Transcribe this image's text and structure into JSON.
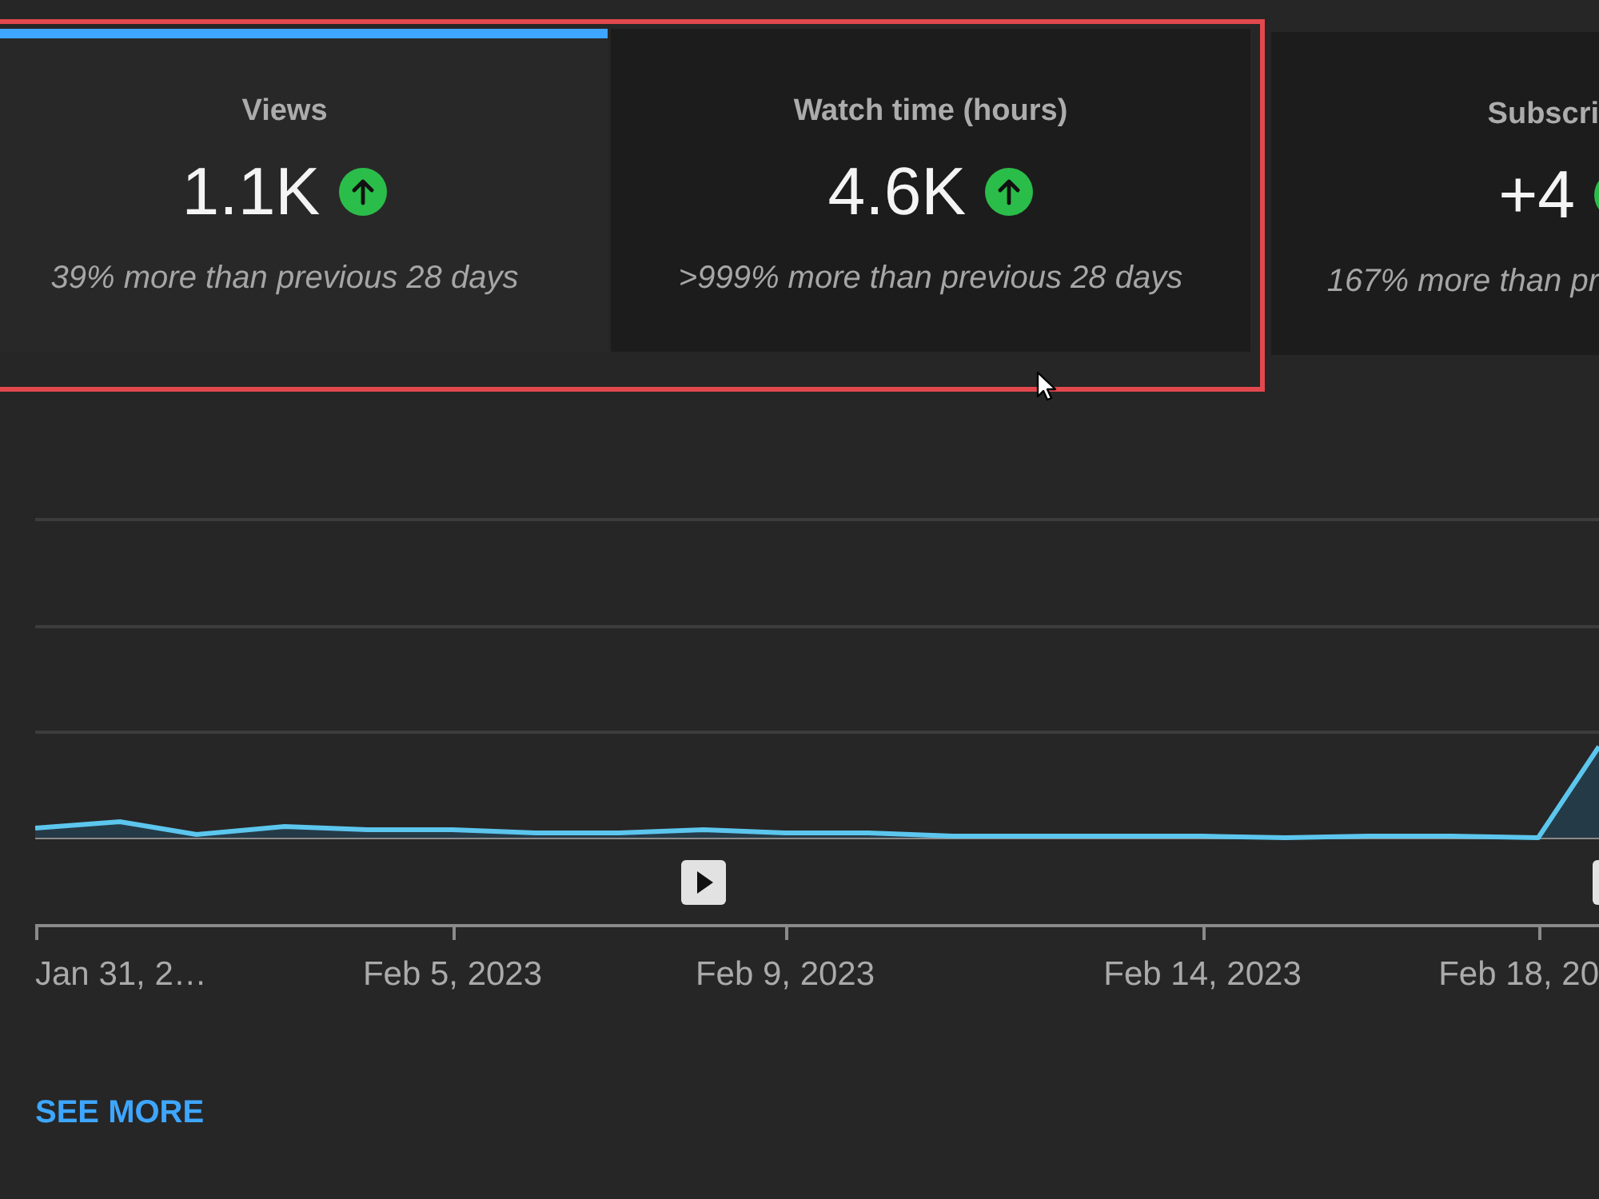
{
  "metric_cards": [
    {
      "title": "Views",
      "value": "1.1K",
      "increased": true,
      "comparison": "39% more than previous 28 days",
      "selected": true
    },
    {
      "title": "Watch time (hours)",
      "value": "4.6K",
      "increased": true,
      "comparison": ">999% more than previous 28 days",
      "selected": false
    },
    {
      "title": "Subscri",
      "value": "+4",
      "increased": true,
      "comparison": "167% more than pr",
      "selected": false
    }
  ],
  "chart": {
    "x_axis_labels": [
      "Jan 31, 2…",
      "Feb 5, 2023",
      "Feb 9, 2023",
      "Feb 14, 2023",
      "Feb 18, 20"
    ]
  },
  "see_more_link": "SEE MORE"
}
